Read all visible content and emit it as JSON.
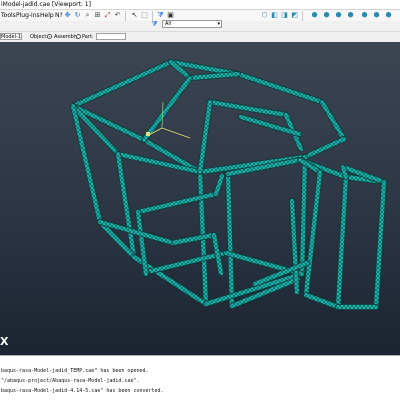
{
  "window": {
    "title": "iModel-jadid.cae [Viewport: 1]"
  },
  "menu": {
    "items": [
      "Tools",
      "Plug-ins",
      "Help",
      "N?"
    ]
  },
  "toolbar": {
    "filter_value": "All",
    "icons": [
      "pan-icon",
      "rotate-icon",
      "magnify-icon",
      "zoom-box-icon",
      "auto-fit-icon",
      "cycle-view-icon",
      "select-icon",
      "box-select-icon",
      "filter-icon",
      "toggle-icon",
      "iso-view-icon",
      "front-view-icon",
      "top-view-icon",
      "side-view-icon",
      "render-wire-icon",
      "render-shaded-icon",
      "render-hidden-icon",
      "perspective-icon"
    ]
  },
  "context": {
    "model_label": "Model-1",
    "object_label": "Object:",
    "assembly_label": "Assembly",
    "part_label": "Part:",
    "assembly_selected": true
  },
  "viewport": {
    "triad_label": "X",
    "mesh_color": "#1fbdb6",
    "edge_color": "#0a3d3b",
    "background_top": "#3c4552",
    "background_bottom": "#1c2431"
  },
  "messages": [
    "baqus-rasa-Model-jadid_TEMP.cae\" has been opened.",
    "\"/abaqus-project/Abaqus-rasa-Model-jadid.cae\".",
    "baqus-rasa-Model-jadid-4.14-5.cae\" has been converted."
  ]
}
